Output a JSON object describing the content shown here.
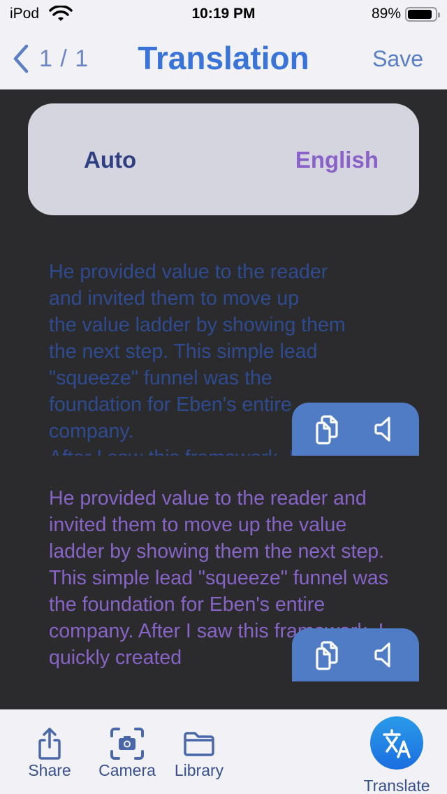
{
  "status_bar": {
    "carrier": "iPod",
    "time": "10:19 PM",
    "battery_percent": "89%",
    "battery_level": 0.89
  },
  "nav": {
    "back_icon": "chevron-left-icon",
    "page_indicator": "1 / 1",
    "title": "Translation",
    "save_label": "Save"
  },
  "languages": {
    "source": "Auto",
    "target": "English"
  },
  "source_text": "He provided value to the reader\nand invited them to move up\nthe value ladder by showing them\nthe next step. This simple lead\n\"squeeze\" funnel was the\nfoundation for Eben's entire\ncompany.\nAfter I saw this framework, I quickly created",
  "translated_text": "He provided value to the reader and invited them to move up the value ladder by showing them the next step. This simple lead \"squeeze\" funnel was the foundation for Eben's entire company. After I saw this framework, I quickly created",
  "actions": {
    "copy_icon": "copy-icon",
    "speak_icon": "speaker-icon"
  },
  "tab_bar": {
    "items": [
      {
        "label": "Share",
        "icon": "share-icon"
      },
      {
        "label": "Camera",
        "icon": "camera-icon"
      },
      {
        "label": "Library",
        "icon": "folder-icon"
      },
      {
        "label": "Translate",
        "icon": "translate-icon"
      }
    ]
  },
  "colors": {
    "accent": "#3a74d8",
    "source_text": "#2f4b90",
    "translated_text": "#8764c6",
    "action_pill": "#4f7cc4",
    "background": "#2b2b2d"
  }
}
